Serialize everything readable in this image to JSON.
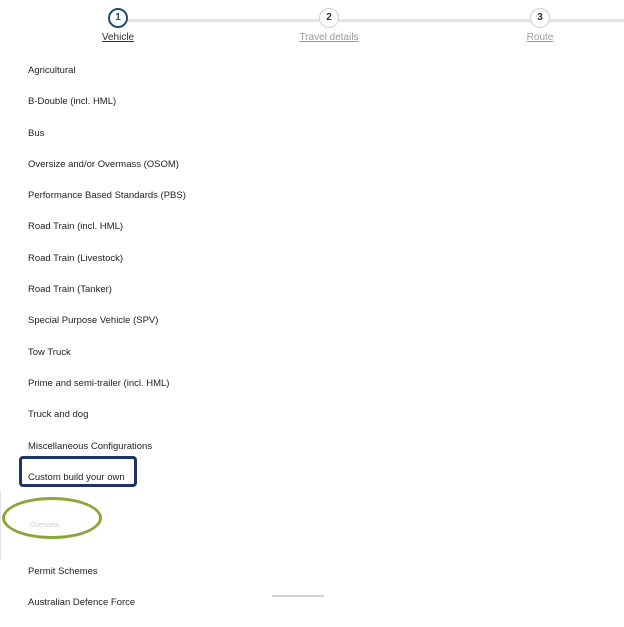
{
  "stepper": {
    "steps": [
      {
        "number": "1",
        "label": "Vehicle",
        "active": true
      },
      {
        "number": "2",
        "label": "Travel details",
        "active": false
      },
      {
        "number": "3",
        "label": "Route",
        "active": false
      }
    ]
  },
  "vehicle_list": {
    "items": [
      "Agricultural",
      "B-Double (incl. HML)",
      "Bus",
      "Oversize and/or Overmass (OSOM)",
      "Performance Based Standards (PBS)",
      "Road Train (incl. HML)",
      "Road Train (Livestock)",
      "Road Train (Tanker)",
      "Special Purpose Vehicle (SPV)",
      "Tow Truck",
      "Prime and semi-trailer (incl. HML)",
      "Truck and dog",
      "Miscellaneous Configurations",
      "Custom build your own"
    ],
    "faded_item": "Overview",
    "items_after": [
      "Permit Schemes",
      "Australian Defence Force"
    ]
  },
  "annotations": {
    "highlight_color": "#1c3566",
    "ellipse_color": "#8aa63a"
  }
}
